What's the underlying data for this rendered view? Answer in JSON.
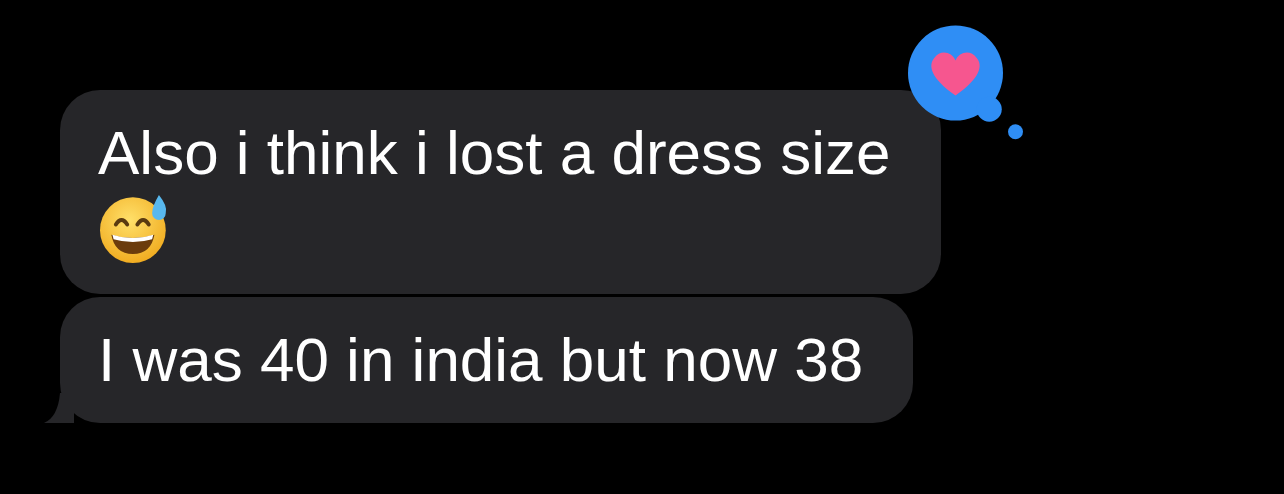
{
  "messages": [
    {
      "text": "Also i think i lost a dress size",
      "emoji": true,
      "heart": true,
      "tail": false
    },
    {
      "text": "I was 40 in india but now 38",
      "emoji": false,
      "heart": false,
      "tail": true
    }
  ]
}
